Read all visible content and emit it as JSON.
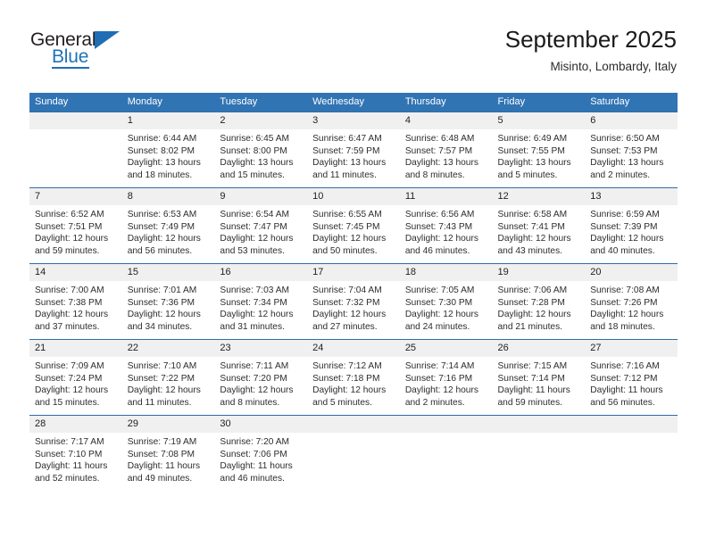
{
  "logo": {
    "word_top": "General",
    "word_bottom": "Blue",
    "accent_color": "#1f6eb4"
  },
  "header": {
    "title": "September 2025",
    "subtitle": "Misinto, Lombardy, Italy"
  },
  "theme": {
    "header_row_bg": "#3174b4",
    "day_band_bg": "#f0f0f0",
    "row_border": "#2e6da4",
    "text": "#2d2d2d"
  },
  "weekday_headers": [
    "Sunday",
    "Monday",
    "Tuesday",
    "Wednesday",
    "Thursday",
    "Friday",
    "Saturday"
  ],
  "weeks": [
    [
      {
        "day": "",
        "sunrise": "",
        "sunset": "",
        "daylight_line1": "",
        "daylight_line2": "",
        "empty": true
      },
      {
        "day": "1",
        "sunrise": "Sunrise: 6:44 AM",
        "sunset": "Sunset: 8:02 PM",
        "daylight_line1": "Daylight: 13 hours",
        "daylight_line2": "and 18 minutes."
      },
      {
        "day": "2",
        "sunrise": "Sunrise: 6:45 AM",
        "sunset": "Sunset: 8:00 PM",
        "daylight_line1": "Daylight: 13 hours",
        "daylight_line2": "and 15 minutes."
      },
      {
        "day": "3",
        "sunrise": "Sunrise: 6:47 AM",
        "sunset": "Sunset: 7:59 PM",
        "daylight_line1": "Daylight: 13 hours",
        "daylight_line2": "and 11 minutes."
      },
      {
        "day": "4",
        "sunrise": "Sunrise: 6:48 AM",
        "sunset": "Sunset: 7:57 PM",
        "daylight_line1": "Daylight: 13 hours",
        "daylight_line2": "and 8 minutes."
      },
      {
        "day": "5",
        "sunrise": "Sunrise: 6:49 AM",
        "sunset": "Sunset: 7:55 PM",
        "daylight_line1": "Daylight: 13 hours",
        "daylight_line2": "and 5 minutes."
      },
      {
        "day": "6",
        "sunrise": "Sunrise: 6:50 AM",
        "sunset": "Sunset: 7:53 PM",
        "daylight_line1": "Daylight: 13 hours",
        "daylight_line2": "and 2 minutes."
      }
    ],
    [
      {
        "day": "7",
        "sunrise": "Sunrise: 6:52 AM",
        "sunset": "Sunset: 7:51 PM",
        "daylight_line1": "Daylight: 12 hours",
        "daylight_line2": "and 59 minutes."
      },
      {
        "day": "8",
        "sunrise": "Sunrise: 6:53 AM",
        "sunset": "Sunset: 7:49 PM",
        "daylight_line1": "Daylight: 12 hours",
        "daylight_line2": "and 56 minutes."
      },
      {
        "day": "9",
        "sunrise": "Sunrise: 6:54 AM",
        "sunset": "Sunset: 7:47 PM",
        "daylight_line1": "Daylight: 12 hours",
        "daylight_line2": "and 53 minutes."
      },
      {
        "day": "10",
        "sunrise": "Sunrise: 6:55 AM",
        "sunset": "Sunset: 7:45 PM",
        "daylight_line1": "Daylight: 12 hours",
        "daylight_line2": "and 50 minutes."
      },
      {
        "day": "11",
        "sunrise": "Sunrise: 6:56 AM",
        "sunset": "Sunset: 7:43 PM",
        "daylight_line1": "Daylight: 12 hours",
        "daylight_line2": "and 46 minutes."
      },
      {
        "day": "12",
        "sunrise": "Sunrise: 6:58 AM",
        "sunset": "Sunset: 7:41 PM",
        "daylight_line1": "Daylight: 12 hours",
        "daylight_line2": "and 43 minutes."
      },
      {
        "day": "13",
        "sunrise": "Sunrise: 6:59 AM",
        "sunset": "Sunset: 7:39 PM",
        "daylight_line1": "Daylight: 12 hours",
        "daylight_line2": "and 40 minutes."
      }
    ],
    [
      {
        "day": "14",
        "sunrise": "Sunrise: 7:00 AM",
        "sunset": "Sunset: 7:38 PM",
        "daylight_line1": "Daylight: 12 hours",
        "daylight_line2": "and 37 minutes."
      },
      {
        "day": "15",
        "sunrise": "Sunrise: 7:01 AM",
        "sunset": "Sunset: 7:36 PM",
        "daylight_line1": "Daylight: 12 hours",
        "daylight_line2": "and 34 minutes."
      },
      {
        "day": "16",
        "sunrise": "Sunrise: 7:03 AM",
        "sunset": "Sunset: 7:34 PM",
        "daylight_line1": "Daylight: 12 hours",
        "daylight_line2": "and 31 minutes."
      },
      {
        "day": "17",
        "sunrise": "Sunrise: 7:04 AM",
        "sunset": "Sunset: 7:32 PM",
        "daylight_line1": "Daylight: 12 hours",
        "daylight_line2": "and 27 minutes."
      },
      {
        "day": "18",
        "sunrise": "Sunrise: 7:05 AM",
        "sunset": "Sunset: 7:30 PM",
        "daylight_line1": "Daylight: 12 hours",
        "daylight_line2": "and 24 minutes."
      },
      {
        "day": "19",
        "sunrise": "Sunrise: 7:06 AM",
        "sunset": "Sunset: 7:28 PM",
        "daylight_line1": "Daylight: 12 hours",
        "daylight_line2": "and 21 minutes."
      },
      {
        "day": "20",
        "sunrise": "Sunrise: 7:08 AM",
        "sunset": "Sunset: 7:26 PM",
        "daylight_line1": "Daylight: 12 hours",
        "daylight_line2": "and 18 minutes."
      }
    ],
    [
      {
        "day": "21",
        "sunrise": "Sunrise: 7:09 AM",
        "sunset": "Sunset: 7:24 PM",
        "daylight_line1": "Daylight: 12 hours",
        "daylight_line2": "and 15 minutes."
      },
      {
        "day": "22",
        "sunrise": "Sunrise: 7:10 AM",
        "sunset": "Sunset: 7:22 PM",
        "daylight_line1": "Daylight: 12 hours",
        "daylight_line2": "and 11 minutes."
      },
      {
        "day": "23",
        "sunrise": "Sunrise: 7:11 AM",
        "sunset": "Sunset: 7:20 PM",
        "daylight_line1": "Daylight: 12 hours",
        "daylight_line2": "and 8 minutes."
      },
      {
        "day": "24",
        "sunrise": "Sunrise: 7:12 AM",
        "sunset": "Sunset: 7:18 PM",
        "daylight_line1": "Daylight: 12 hours",
        "daylight_line2": "and 5 minutes."
      },
      {
        "day": "25",
        "sunrise": "Sunrise: 7:14 AM",
        "sunset": "Sunset: 7:16 PM",
        "daylight_line1": "Daylight: 12 hours",
        "daylight_line2": "and 2 minutes."
      },
      {
        "day": "26",
        "sunrise": "Sunrise: 7:15 AM",
        "sunset": "Sunset: 7:14 PM",
        "daylight_line1": "Daylight: 11 hours",
        "daylight_line2": "and 59 minutes."
      },
      {
        "day": "27",
        "sunrise": "Sunrise: 7:16 AM",
        "sunset": "Sunset: 7:12 PM",
        "daylight_line1": "Daylight: 11 hours",
        "daylight_line2": "and 56 minutes."
      }
    ],
    [
      {
        "day": "28",
        "sunrise": "Sunrise: 7:17 AM",
        "sunset": "Sunset: 7:10 PM",
        "daylight_line1": "Daylight: 11 hours",
        "daylight_line2": "and 52 minutes."
      },
      {
        "day": "29",
        "sunrise": "Sunrise: 7:19 AM",
        "sunset": "Sunset: 7:08 PM",
        "daylight_line1": "Daylight: 11 hours",
        "daylight_line2": "and 49 minutes."
      },
      {
        "day": "30",
        "sunrise": "Sunrise: 7:20 AM",
        "sunset": "Sunset: 7:06 PM",
        "daylight_line1": "Daylight: 11 hours",
        "daylight_line2": "and 46 minutes."
      },
      {
        "day": "",
        "sunrise": "",
        "sunset": "",
        "daylight_line1": "",
        "daylight_line2": "",
        "empty": true
      },
      {
        "day": "",
        "sunrise": "",
        "sunset": "",
        "daylight_line1": "",
        "daylight_line2": "",
        "empty": true
      },
      {
        "day": "",
        "sunrise": "",
        "sunset": "",
        "daylight_line1": "",
        "daylight_line2": "",
        "empty": true
      },
      {
        "day": "",
        "sunrise": "",
        "sunset": "",
        "daylight_line1": "",
        "daylight_line2": "",
        "empty": true
      }
    ]
  ]
}
